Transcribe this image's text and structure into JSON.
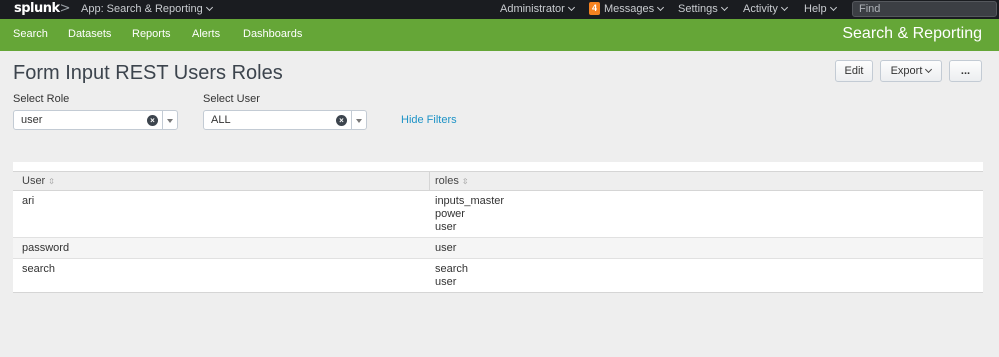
{
  "topbar": {
    "logo": "splunk",
    "logo_chevron": ">",
    "app_menu": "App: Search & Reporting",
    "user_menu": "Administrator",
    "messages_count": "4",
    "messages": "Messages",
    "settings": "Settings",
    "activity": "Activity",
    "help": "Help",
    "find_placeholder": "Find"
  },
  "appbar": {
    "nav": [
      "Search",
      "Datasets",
      "Reports",
      "Alerts",
      "Dashboards"
    ],
    "app_title": "Search & Reporting",
    "accent_color": "#65a637"
  },
  "dashboard": {
    "title": "Form Input REST Users Roles",
    "edit": "Edit",
    "export": "Export",
    "more": "..."
  },
  "filters": {
    "role": {
      "label": "Select Role",
      "value": "user"
    },
    "user": {
      "label": "Select User",
      "value": "ALL"
    },
    "hide_filters": "Hide Filters",
    "clear_glyph": "×",
    "sort_glyph": "⇳"
  },
  "table": {
    "headers": [
      "User",
      "roles"
    ],
    "rows": [
      {
        "user": "ari",
        "roles": [
          "inputs_master",
          "power",
          "user"
        ]
      },
      {
        "user": "password",
        "roles": [
          "user"
        ]
      },
      {
        "user": "search",
        "roles": [
          "search",
          "user"
        ]
      }
    ]
  }
}
